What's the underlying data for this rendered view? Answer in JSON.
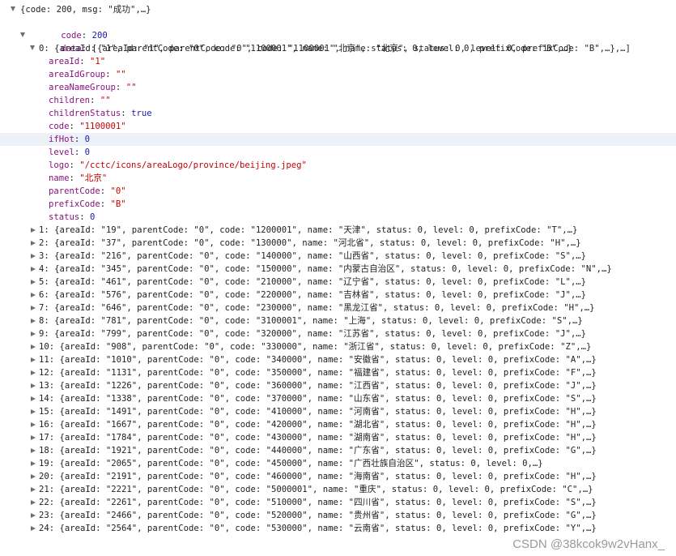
{
  "root_summary": "{code: 200, msg: \"成功\",…}",
  "code_key": "code",
  "code_value": "200",
  "data_key": "data",
  "data_summary": "[{areaId: \"1\", parentCode: \"0\", code: \"1100001\", name: \"北京\", status: 0, level: 0, prefixCode: \"B\",…},…]",
  "item0_summary": "0: {areaId: \"1\", parentCode: \"0\", code: \"1100001\", name: \"北京\", status: 0, level: 0, prefixCode: \"B\",…}",
  "item0_fields": [
    {
      "key": "areaId",
      "value": "\"1\"",
      "type": "str"
    },
    {
      "key": "areaIdGroup",
      "value": "\"\"",
      "type": "str"
    },
    {
      "key": "areaNameGroup",
      "value": "\"\"",
      "type": "str"
    },
    {
      "key": "children",
      "value": "\"\"",
      "type": "str"
    },
    {
      "key": "childrenStatus",
      "value": "true",
      "type": "bool"
    },
    {
      "key": "code",
      "value": "\"1100001\"",
      "type": "str"
    },
    {
      "key": "ifHot",
      "value": "0",
      "type": "num"
    },
    {
      "key": "level",
      "value": "0",
      "type": "num"
    },
    {
      "key": "logo",
      "value": "\"/cctc/icons/areaLogo/province/beijing.jpeg\"",
      "type": "str"
    },
    {
      "key": "name",
      "value": "\"北京\"",
      "type": "str"
    },
    {
      "key": "parentCode",
      "value": "\"0\"",
      "type": "str"
    },
    {
      "key": "prefixCode",
      "value": "\"B\"",
      "type": "str"
    },
    {
      "key": "status",
      "value": "0",
      "type": "num"
    }
  ],
  "collapsed_items": [
    "1: {areaId: \"19\", parentCode: \"0\", code: \"1200001\", name: \"天津\", status: 0, level: 0, prefixCode: \"T\",…}",
    "2: {areaId: \"37\", parentCode: \"0\", code: \"130000\", name: \"河北省\", status: 0, level: 0, prefixCode: \"H\",…}",
    "3: {areaId: \"216\", parentCode: \"0\", code: \"140000\", name: \"山西省\", status: 0, level: 0, prefixCode: \"S\",…}",
    "4: {areaId: \"345\", parentCode: \"0\", code: \"150000\", name: \"内蒙古自治区\", status: 0, level: 0, prefixCode: \"N\",…}",
    "5: {areaId: \"461\", parentCode: \"0\", code: \"210000\", name: \"辽宁省\", status: 0, level: 0, prefixCode: \"L\",…}",
    "6: {areaId: \"576\", parentCode: \"0\", code: \"220000\", name: \"吉林省\", status: 0, level: 0, prefixCode: \"J\",…}",
    "7: {areaId: \"646\", parentCode: \"0\", code: \"230000\", name: \"黑龙江省\", status: 0, level: 0, prefixCode: \"H\",…}",
    "8: {areaId: \"781\", parentCode: \"0\", code: \"3100001\", name: \"上海\", status: 0, level: 0, prefixCode: \"S\",…}",
    "9: {areaId: \"799\", parentCode: \"0\", code: \"320000\", name: \"江苏省\", status: 0, level: 0, prefixCode: \"J\",…}",
    "10: {areaId: \"908\", parentCode: \"0\", code: \"330000\", name: \"浙江省\", status: 0, level: 0, prefixCode: \"Z\",…}",
    "11: {areaId: \"1010\", parentCode: \"0\", code: \"340000\", name: \"安徽省\", status: 0, level: 0, prefixCode: \"A\",…}",
    "12: {areaId: \"1131\", parentCode: \"0\", code: \"350000\", name: \"福建省\", status: 0, level: 0, prefixCode: \"F\",…}",
    "13: {areaId: \"1226\", parentCode: \"0\", code: \"360000\", name: \"江西省\", status: 0, level: 0, prefixCode: \"J\",…}",
    "14: {areaId: \"1338\", parentCode: \"0\", code: \"370000\", name: \"山东省\", status: 0, level: 0, prefixCode: \"S\",…}",
    "15: {areaId: \"1491\", parentCode: \"0\", code: \"410000\", name: \"河南省\", status: 0, level: 0, prefixCode: \"H\",…}",
    "16: {areaId: \"1667\", parentCode: \"0\", code: \"420000\", name: \"湖北省\", status: 0, level: 0, prefixCode: \"H\",…}",
    "17: {areaId: \"1784\", parentCode: \"0\", code: \"430000\", name: \"湖南省\", status: 0, level: 0, prefixCode: \"H\",…}",
    "18: {areaId: \"1921\", parentCode: \"0\", code: \"440000\", name: \"广东省\", status: 0, level: 0, prefixCode: \"G\",…}",
    "19: {areaId: \"2065\", parentCode: \"0\", code: \"450000\", name: \"广西壮族自治区\", status: 0, level: 0,…}",
    "20: {areaId: \"2191\", parentCode: \"0\", code: \"460000\", name: \"海南省\", status: 0, level: 0, prefixCode: \"H\",…}",
    "21: {areaId: \"2221\", parentCode: \"0\", code: \"5000001\", name: \"重庆\", status: 0, level: 0, prefixCode: \"C\",…}",
    "22: {areaId: \"2261\", parentCode: \"0\", code: \"510000\", name: \"四川省\", status: 0, level: 0, prefixCode: \"S\",…}",
    "23: {areaId: \"2466\", parentCode: \"0\", code: \"520000\", name: \"贵州省\", status: 0, level: 0, prefixCode: \"G\",…}",
    "24: {areaId: \"2564\", parentCode: \"0\", code: \"530000\", name: \"云南省\", status: 0, level: 0, prefixCode: \"Y\",…}"
  ],
  "watermark": "CSDN @38kcok9w2vHanx_",
  "colors": {
    "key": "#881280",
    "string": "#c80000",
    "number": "#1a1aa6",
    "highlight": "#ecf1f8",
    "toggle": "#6e6e6e"
  }
}
